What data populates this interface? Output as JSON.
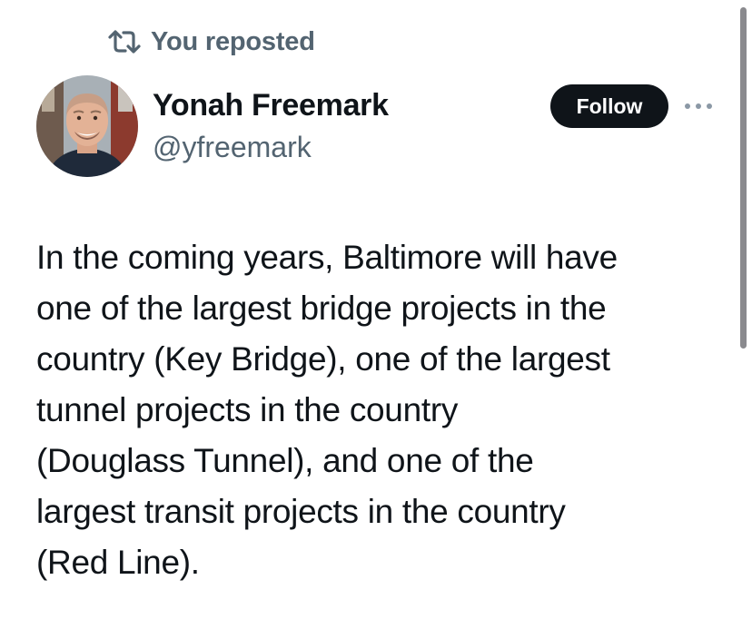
{
  "repost": {
    "icon": "repost-icon",
    "label": "You reposted"
  },
  "author": {
    "avatar": "profile-photo",
    "display_name": "Yonah Freemark",
    "handle": "@yfreemark"
  },
  "actions": {
    "follow_label": "Follow",
    "more_icon": "more-options-icon"
  },
  "tweet": {
    "lines": [
      "In the coming years, Baltimore will have",
      "one of the largest bridge projects in the",
      "country (Key Bridge), one of the largest",
      "tunnel projects in the country",
      "(Douglass Tunnel), and one of the",
      "largest transit projects in the country",
      "(Red Line)."
    ]
  },
  "colors": {
    "text_primary": "#0f1419",
    "text_secondary": "#536471",
    "follow_button_bg": "#0f1419",
    "follow_button_text": "#ffffff",
    "scrollbar": "#8a8a8e"
  }
}
